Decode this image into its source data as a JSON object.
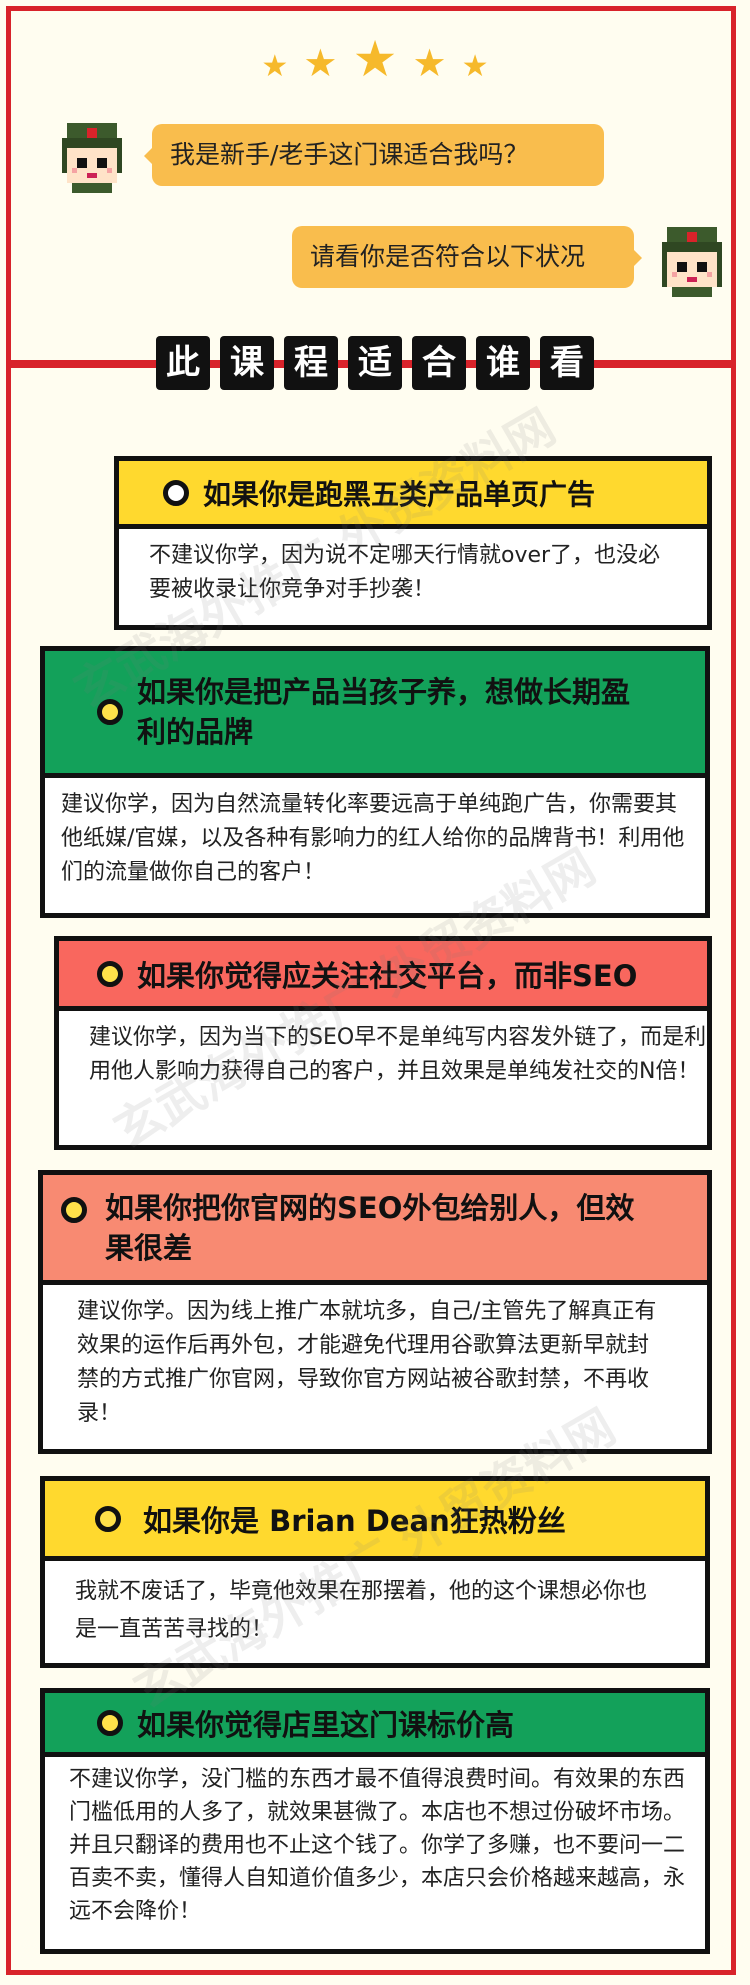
{
  "header": {
    "stars": [
      "★",
      "★",
      "★",
      "★",
      "★"
    ],
    "question": "我是新手/老手这门课适合我吗？",
    "answer": "请看你是否符合以下状况"
  },
  "section_title": [
    "此",
    "课",
    "程",
    "适",
    "合",
    "谁",
    "看"
  ],
  "cards": [
    {
      "heading": "如果你是跑黑五类产品单页广告",
      "body": "不建议你学，因为说不定哪天行情就over了，也没必要被收录让你竞争对手抄袭！"
    },
    {
      "heading": "如果你是把产品当孩子养，想做长期盈利的品牌",
      "body": "建议你学，因为自然流量转化率要远高于单纯跑广告，你需要其他纸媒/官媒，以及各种有影响力的红人给你的品牌背书！利用他们的流量做你自己的客户！"
    },
    {
      "heading": "如果你觉得应关注社交平台，而非SEO",
      "body": "建议你学，因为当下的SEO早不是单纯写内容发外链了，而是利用他人影响力获得自己的客户，并且效果是单纯发社交的N倍！"
    },
    {
      "heading": "如果你把你官网的SEO外包给别人，但效果很差",
      "body": "建议你学。因为线上推广本就坑多，自己/主管先了解真正有效果的运作后再外包，才能避免代理用谷歌算法更新早就封禁的方式推广你官网，导致你官方网站被谷歌封禁，不再收录！"
    },
    {
      "heading": "如果你是 Brian Dean狂热粉丝",
      "body": "我就不废话了，毕竟他效果在那摆着，他的这个课想必你也是一直苦苦寻找的！"
    },
    {
      "heading": "如果你觉得店里这门课标价高",
      "body": "不建议你学，没门槛的东西才最不值得浪费时间。有效果的东西门槛低用的人多了，就效果甚微了。本店也不想过份破坏市场。并且只翻译的费用也不止这个钱了。你学了多赚，也不要问一二百卖不卖，懂得人自知道价值多少，本店只会价格越来越高，永远不会降价！"
    }
  ],
  "watermark": "玄武海外推广 外贸资料网",
  "colors": {
    "red": "#d8232a",
    "yellow": "#ffd92e",
    "green": "#13a15a",
    "coral": "#f9675e",
    "salmon": "#f88a72",
    "bubble": "#f9bd4d"
  }
}
